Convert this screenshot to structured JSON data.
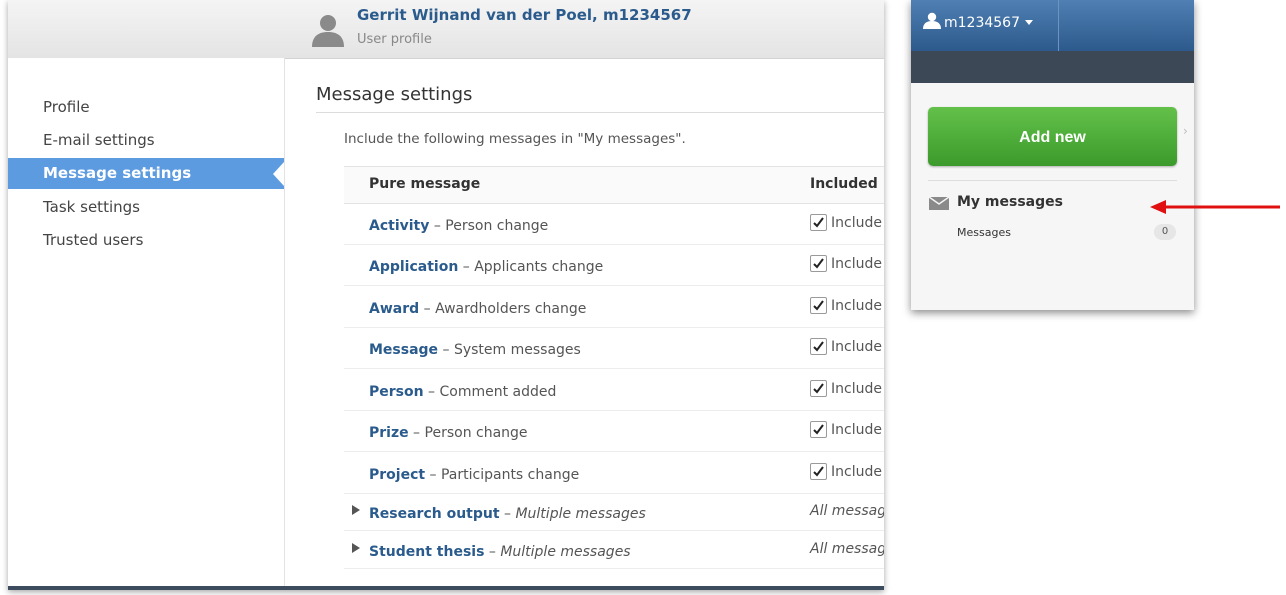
{
  "header": {
    "user_name": "Gerrit Wijnand van der Poel, m1234567",
    "subtitle": "User profile"
  },
  "sidebar": {
    "items": [
      {
        "label": "Profile",
        "active": false
      },
      {
        "label": "E-mail settings",
        "active": false
      },
      {
        "label": "Message settings",
        "active": true
      },
      {
        "label": "Task settings",
        "active": false
      },
      {
        "label": "Trusted users",
        "active": false
      }
    ]
  },
  "main": {
    "title": "Message settings",
    "intro": "Include the following messages in \"My messages\".",
    "table": {
      "headers": [
        "Pure message",
        "Included"
      ],
      "rows": [
        {
          "category": "Activity",
          "description": "Person change",
          "status": "Include",
          "checked": true
        },
        {
          "category": "Application",
          "description": "Applicants change",
          "status": "Include",
          "checked": true
        },
        {
          "category": "Award",
          "description": "Awardholders change",
          "status": "Include",
          "checked": true
        },
        {
          "category": "Message",
          "description": "System messages",
          "status": "Include",
          "checked": true
        },
        {
          "category": "Person",
          "description": "Comment added",
          "status": "Include",
          "checked": true
        },
        {
          "category": "Prize",
          "description": "Person change",
          "status": "Include",
          "checked": true
        },
        {
          "category": "Project",
          "description": "Participants change",
          "status": "Include",
          "checked": true
        }
      ],
      "group_rows": [
        {
          "category": "Research output",
          "description": "Multiple messages",
          "status": "All messag"
        },
        {
          "category": "Student thesis",
          "description": "Multiple messages",
          "status": "All messag"
        }
      ]
    }
  },
  "right_panel": {
    "user_menu": "m1234567",
    "add_new_label": "Add new",
    "my_messages_label": "My messages",
    "messages_link": "Messages",
    "messages_count": "0"
  },
  "colors": {
    "accent_blue": "#5d9be0",
    "link_blue": "#2a5b8c",
    "add_green": "#4aaa36",
    "arrow_red": "#e01010"
  }
}
